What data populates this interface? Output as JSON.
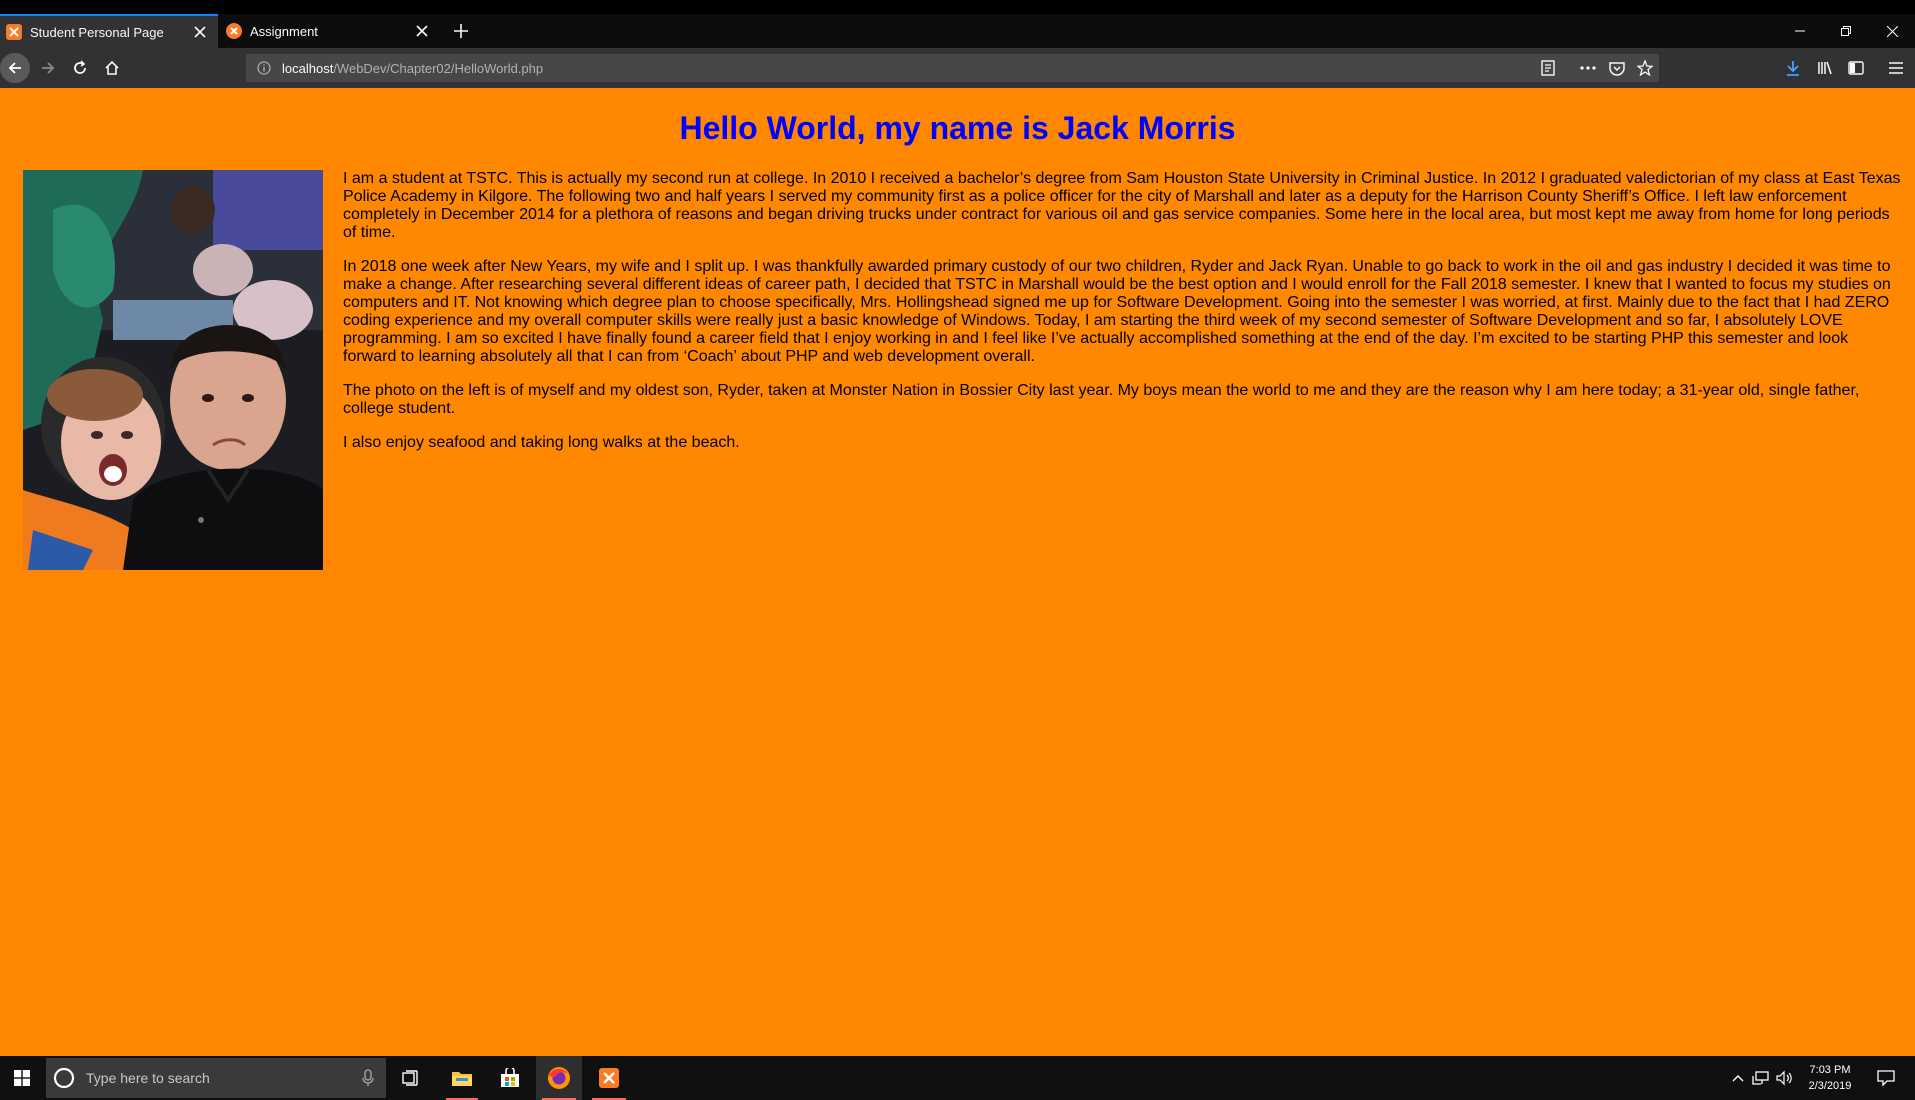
{
  "browser": {
    "tabs": [
      {
        "label": "Student Personal Page",
        "active": true
      },
      {
        "label": "Assignment",
        "active": false
      }
    ],
    "url_host": "localhost",
    "url_path": "/WebDev/Chapter02/HelloWorld.php"
  },
  "page": {
    "heading": "Hello World, my name is Jack Morris",
    "background_color": "#ff8800",
    "heading_color": "#0000ff",
    "paragraphs": [
      "I am a student at TSTC. This is actually my second run at college. In 2010 I received a bachelor’s degree from Sam Houston State University in Criminal Justice. In 2012 I graduated valedictorian of my class at East Texas Police Academy in Kilgore. The following two and half years I served my community first as a police officer for the city of Marshall and later as a deputy for the Harrison County Sheriff’s Office. I left law enforcement completely in December 2014 for a plethora of reasons and began driving trucks under contract for various oil and gas service companies. Some here in the local area, but most kept me away from home for long periods of time.",
      "In 2018 one week after New Years, my wife and I split up. I was thankfully awarded primary custody of our two children, Ryder and Jack Ryan. Unable to go back to work in the oil and gas industry I decided it was time to make a change. After researching several different ideas of career path, I decided that TSTC in Marshall would be the best option and I would enroll for the Fall 2018 semester. I knew that I wanted to focus my studies on computers and IT. Not knowing which degree plan to choose specifically, Mrs. Hollingshead signed me up for Software Development. Going into the semester I was worried, at first. Mainly due to the fact that I had ZERO coding experience and my overall computer skills were really just a basic knowledge of Windows. Today, I am starting the third week of my second semester of Software Development and so far, I absolutely LOVE programming. I am so excited I have finally found a career field that I enjoy working in and I feel like I’ve actually accomplished something at the end of the day. I’m excited to be starting PHP this semester and look forward to learning absolutely all that I can from ‘Coach’ about PHP and web development overall.",
      "The photo on the left is of myself and my oldest son, Ryder, taken at Monster Nation in Bossier City last year. My boys mean the world to me and they are the reason why I am here today; a 31-year old, single father, college student.",
      "I also enjoy seafood and taking long walks at the beach."
    ]
  },
  "taskbar": {
    "search_placeholder": "Type here to search",
    "time": "7:03 PM",
    "date": "2/3/2019"
  }
}
